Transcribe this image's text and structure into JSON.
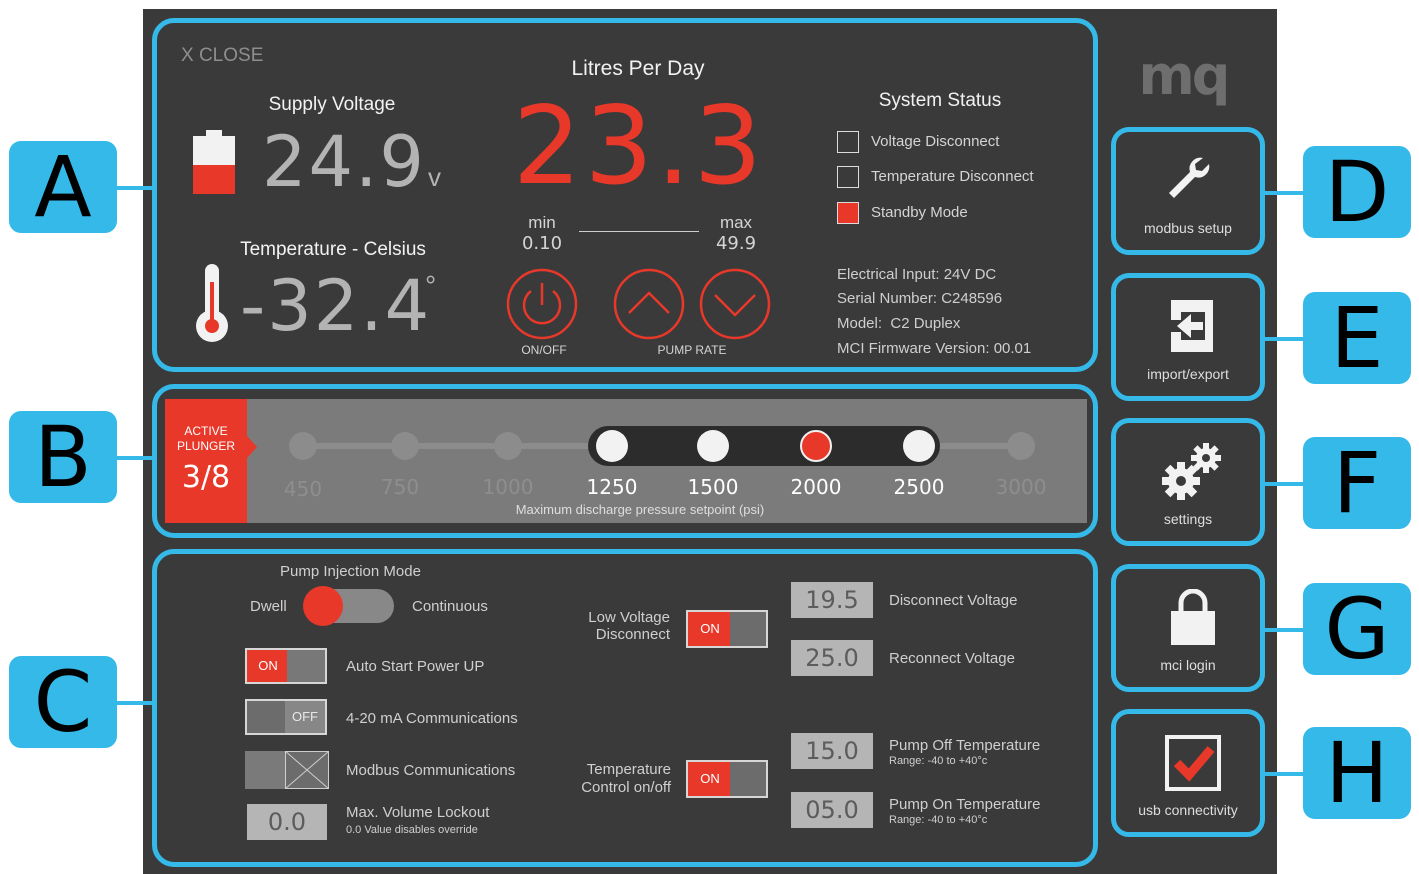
{
  "brand": {
    "logo_text": "mq"
  },
  "callouts": [
    "A",
    "B",
    "C",
    "D",
    "E",
    "F",
    "G",
    "H"
  ],
  "colors": {
    "accent_blue": "#35b9e8",
    "alert_red": "#e8382a",
    "panel_bg": "#3a3a3a"
  },
  "panel_a": {
    "close_label": "X CLOSE",
    "supply_voltage": {
      "title": "Supply Voltage",
      "value": "24.9",
      "unit": "v",
      "battery_level": 0.5
    },
    "temperature": {
      "title": "Temperature - Celsius",
      "value": "-32.4",
      "unit": "°"
    },
    "lpd": {
      "title": "Litres Per Day",
      "value": "23.3",
      "min_label": "min",
      "min_value": "0.10",
      "max_label": "max",
      "max_value": "49.9"
    },
    "controls": {
      "on_off_label": "ON/OFF",
      "pump_rate_label": "PUMP RATE"
    },
    "system_status": {
      "title": "System Status",
      "items": [
        {
          "label": "Voltage Disconnect",
          "active": false
        },
        {
          "label": "Temperature Disconnect",
          "active": false
        },
        {
          "label": "Standby Mode",
          "active": true
        }
      ]
    },
    "info": [
      "Electrical Input: 24V DC",
      "Serial Number: C248596",
      "Model:  C2 Duplex",
      "MCI Firmware Version: 00.01"
    ]
  },
  "panel_b": {
    "plunger_label_1": "ACTIVE",
    "plunger_label_2": "PLUNGER",
    "plunger_size": "3/8",
    "pressures": [
      "450",
      "750",
      "1000",
      "1250",
      "1500",
      "2000",
      "2500",
      "3000"
    ],
    "caption": "Maximum discharge pressure setpoint (psi)"
  },
  "panel_c": {
    "injection_mode": {
      "title": "Pump Injection Mode",
      "left": "Dwell",
      "right": "Continuous"
    },
    "auto_start": {
      "state": "ON",
      "label": "Auto Start Power UP"
    },
    "ma_comms": {
      "state": "OFF",
      "label": "4-20 mA Communications"
    },
    "modbus": {
      "label": "Modbus Communications"
    },
    "max_volume": {
      "value": "0.0",
      "label": "Max. Volume Lockout",
      "sublabel": "0.0 Value disables override"
    },
    "low_voltage": {
      "label_1": "Low Voltage",
      "label_2": "Disconnect",
      "state": "ON"
    },
    "disconnect_voltage": {
      "value": "19.5",
      "label": "Disconnect Voltage"
    },
    "reconnect_voltage": {
      "value": "25.0",
      "label": "Reconnect Voltage"
    },
    "temp_control": {
      "label_1": "Temperature",
      "label_2": "Control on/off",
      "state": "ON"
    },
    "pump_off_temp": {
      "value": "15.0",
      "label": "Pump Off Temperature",
      "range": "Range: -40 to +40°c"
    },
    "pump_on_temp": {
      "value": "05.0",
      "label": "Pump On Temperature",
      "range": "Range: -40 to +40°c"
    }
  },
  "sidebar": {
    "modbus_setup": "modbus setup",
    "import_export": "import/export",
    "settings": "settings",
    "mci_login": "mci login",
    "usb_connectivity": "usb connectivity"
  }
}
